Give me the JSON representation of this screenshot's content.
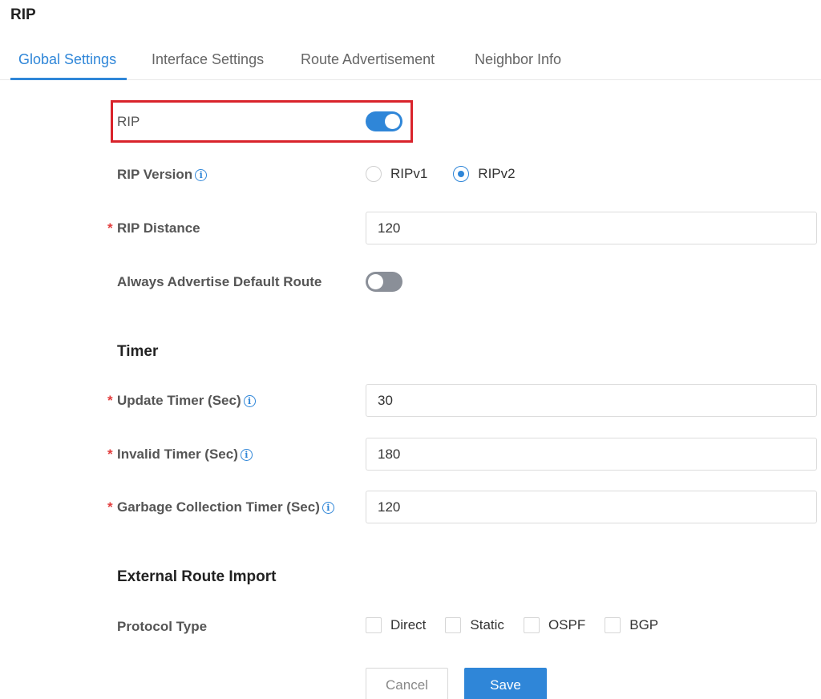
{
  "page": {
    "title": "RIP"
  },
  "tabs": [
    {
      "label": "Global Settings",
      "active": true
    },
    {
      "label": "Interface Settings",
      "active": false
    },
    {
      "label": "Route Advertisement",
      "active": false
    },
    {
      "label": "Neighbor Info",
      "active": false
    }
  ],
  "form": {
    "rip": {
      "label": "RIP",
      "enabled": true
    },
    "rip_version": {
      "label": "RIP Version",
      "options": [
        "RIPv1",
        "RIPv2"
      ],
      "selected": "RIPv2"
    },
    "rip_distance": {
      "label": "RIP Distance",
      "required_mark": "*",
      "value": "120"
    },
    "always_advertise": {
      "label": "Always Advertise Default Route",
      "enabled": false
    }
  },
  "timer": {
    "title": "Timer",
    "update": {
      "label": "Update Timer (Sec)",
      "required_mark": "*",
      "value": "30"
    },
    "invalid": {
      "label": "Invalid Timer (Sec)",
      "required_mark": "*",
      "value": "180"
    },
    "garbage": {
      "label": "Garbage Collection Timer (Sec)",
      "required_mark": "*",
      "value": "120"
    }
  },
  "external": {
    "title": "External Route Import",
    "protocol_type": {
      "label": "Protocol Type",
      "options": [
        "Direct",
        "Static",
        "OSPF",
        "BGP"
      ]
    }
  },
  "buttons": {
    "cancel": "Cancel",
    "save": "Save"
  },
  "icons": {
    "info": "i"
  },
  "colors": {
    "accent": "#2f86d8",
    "highlight": "#d9232b",
    "required": "#e23c3c",
    "toggle_off": "#8a8f98"
  }
}
